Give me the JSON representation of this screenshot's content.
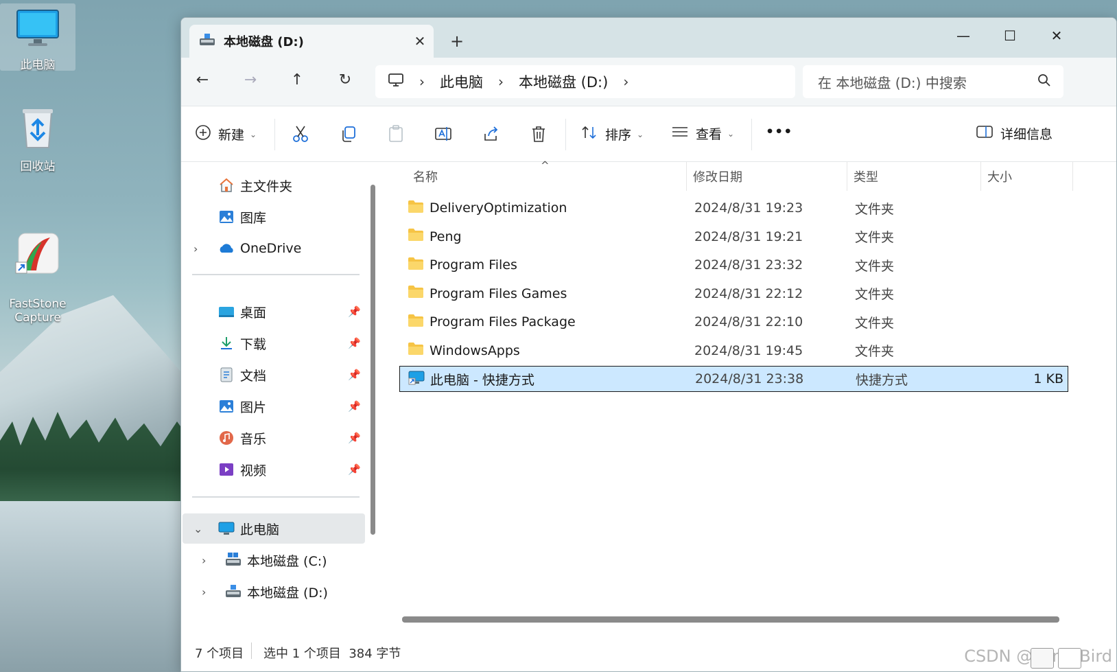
{
  "desktop": {
    "icons": [
      {
        "label": "此电脑"
      },
      {
        "label": "回收站"
      },
      {
        "label": "FastStone\nCapture"
      }
    ]
  },
  "tab": {
    "title": "本地磁盘 (D:)",
    "close": "✕",
    "new_tab": "+"
  },
  "window_controls": {
    "minimize": "—",
    "maximize": "☐",
    "close": "✕"
  },
  "nav": {
    "back": "←",
    "forward": "→",
    "up": "↑",
    "refresh": "↻",
    "breadcrumb": [
      "此电脑",
      "本地磁盘 (D:)"
    ],
    "separator": "›",
    "search_placeholder": "在 本地磁盘 (D:) 中搜索"
  },
  "toolbar": {
    "new_label": "新建",
    "sort_label": "排序",
    "view_label": "查看",
    "more_label": "•••",
    "details_label": "详细信息"
  },
  "sidebar": {
    "items": [
      {
        "label": "主文件夹",
        "icon": "home-icon"
      },
      {
        "label": "图库",
        "icon": "gallery-icon"
      },
      {
        "label": "OneDrive",
        "icon": "onedrive-icon",
        "chevron": "›"
      },
      {
        "label": "桌面",
        "icon": "desktop-icon",
        "pin": "📌"
      },
      {
        "label": "下载",
        "icon": "download-icon",
        "pin": "📌"
      },
      {
        "label": "文档",
        "icon": "documents-icon",
        "pin": "📌"
      },
      {
        "label": "图片",
        "icon": "pictures-icon",
        "pin": "📌"
      },
      {
        "label": "音乐",
        "icon": "music-icon",
        "pin": "📌"
      },
      {
        "label": "视频",
        "icon": "videos-icon",
        "pin": "📌"
      },
      {
        "label": "此电脑",
        "icon": "this-pc-icon",
        "chevron": "⌄"
      },
      {
        "label": "本地磁盘 (C:)",
        "icon": "drive-c-icon",
        "chevron": "›"
      },
      {
        "label": "本地磁盘 (D:)",
        "icon": "drive-d-icon",
        "chevron": "›"
      }
    ]
  },
  "columns": {
    "name": "名称",
    "date": "修改日期",
    "type": "类型",
    "size": "大小",
    "sort_arrow": "^"
  },
  "files": [
    {
      "name": "DeliveryOptimization",
      "date": "2024/8/31 19:23",
      "type": "文件夹",
      "size": ""
    },
    {
      "name": "Peng",
      "date": "2024/8/31 19:21",
      "type": "文件夹",
      "size": ""
    },
    {
      "name": "Program Files",
      "date": "2024/8/31 23:32",
      "type": "文件夹",
      "size": ""
    },
    {
      "name": "Program Files Games",
      "date": "2024/8/31 22:12",
      "type": "文件夹",
      "size": ""
    },
    {
      "name": "Program Files Package",
      "date": "2024/8/31 22:10",
      "type": "文件夹",
      "size": ""
    },
    {
      "name": "WindowsApps",
      "date": "2024/8/31 19:45",
      "type": "文件夹",
      "size": ""
    },
    {
      "name": "此电脑 - 快捷方式",
      "date": "2024/8/31 23:38",
      "type": "快捷方式",
      "size": "1 KB"
    }
  ],
  "status": {
    "count": "7 个项目",
    "selection": "选中 1 个项目  384 字节",
    "watermark": "CSDN @LunarBird"
  },
  "colors": {
    "selection": "#cce8ff",
    "accent": "#0078d4",
    "folder": "#f6c445"
  }
}
